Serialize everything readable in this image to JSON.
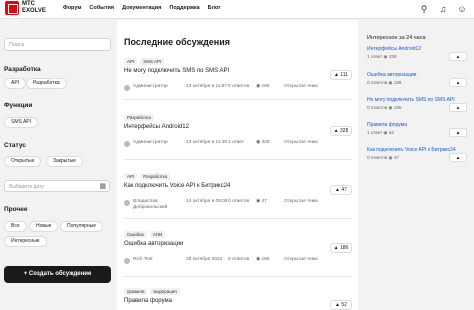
{
  "brand": {
    "line1": "МТС",
    "line2": "EXOLVE"
  },
  "nav": [
    "Форум",
    "События",
    "Документация",
    "Поддержка",
    "Блог"
  ],
  "sidebar": {
    "search_placeholder": "Поиск",
    "dev_title": "Разработка",
    "dev_chips": [
      "API",
      "Разработка"
    ],
    "func_title": "Функции",
    "func_chips": [
      "SMS API"
    ],
    "status_title": "Статус",
    "status_chips": [
      "Открытые",
      "Закрытые"
    ],
    "date_placeholder": "Выберите дату",
    "other_title": "Прочее",
    "other_chips": [
      "Все",
      "Новые",
      "Популярные",
      "Интересные"
    ],
    "create_label": "+ Создать обсуждение"
  },
  "main": {
    "title": "Последние обсуждения",
    "posts": [
      {
        "tags": [
          "API",
          "SMS API"
        ],
        "title": "Не могу подключить SMS по SMS API",
        "votes": "▲ 111",
        "author": "Администратор",
        "date": "13 октября в 11:57",
        "answers": "0 ответов",
        "views": "◉ 195",
        "status": "Открытая тема"
      },
      {
        "tags": [
          "Разработка"
        ],
        "title": "Интерфейсы Android12",
        "votes": "▲ 328",
        "author": "Администратор",
        "date": "13 октября в 11:38",
        "answers": "1 ответ",
        "views": "◉ 328",
        "status": "Открытая тема"
      },
      {
        "tags": [
          "API",
          "Разработка"
        ],
        "title": "Как подключить Voice API к Битрикс24",
        "votes": "▲ 47",
        "author": "Владислав Добровольский",
        "date": "14 октября в 09:08",
        "answers": "0 ответов",
        "views": "◉ 47",
        "status": "Открытая тема"
      },
      {
        "tags": [
          "Ошибка",
          "АПИ"
        ],
        "title": "Ошибка авторизации",
        "votes": "▲ 186",
        "author": "Rich Test",
        "date": "29 октября 2022",
        "answers": "0 ответов",
        "views": "◉ 186",
        "status": "Открытая тема"
      },
      {
        "tags": [
          "правила",
          "модерация"
        ],
        "title": "Правила форума",
        "votes": "▲ 52",
        "author": "",
        "date": "",
        "answers": "",
        "views": "",
        "status": ""
      }
    ]
  },
  "right": {
    "title": "Интересное за 24 часа",
    "items": [
      {
        "link": "Интерфейсы Android12",
        "meta": "1 ответ  ◉ 328"
      },
      {
        "link": "Ошибка авторизации",
        "meta": "0 ответов  ◉ 186"
      },
      {
        "link": "Не могу подключить SMS по SMS API",
        "meta": "0 ответов  ◉ 195"
      },
      {
        "link": "Правила форума",
        "meta": "1 ответ  ◉ 52"
      },
      {
        "link": "Как подключить Voice API к Битрикс24",
        "meta": "0 ответов  ◉ 47"
      }
    ]
  }
}
